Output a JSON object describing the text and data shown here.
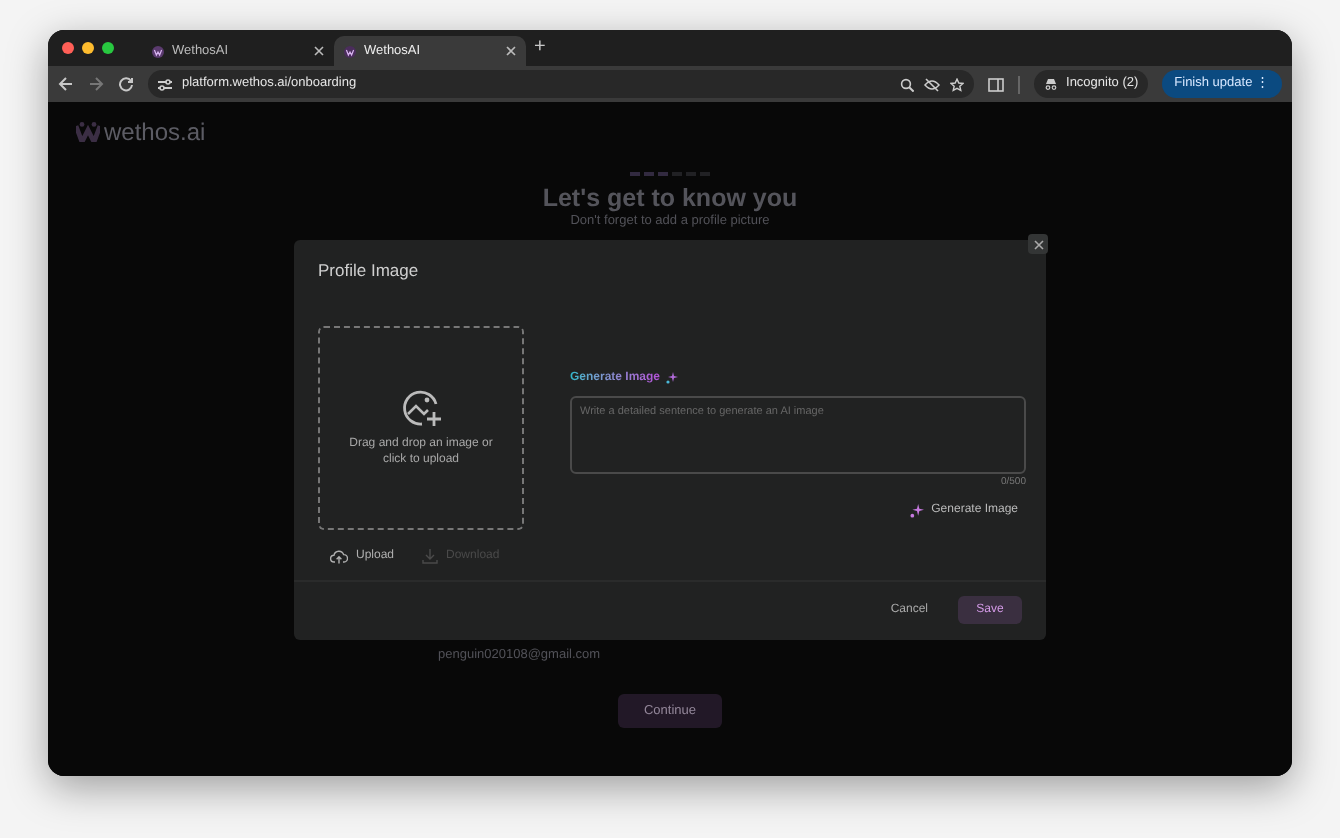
{
  "browser": {
    "tabs": [
      {
        "title": "WethosAI",
        "selected": false
      },
      {
        "title": "WethosAI",
        "selected": true
      }
    ],
    "new_tab_button": "+",
    "url": "platform.wethos.ai/onboarding",
    "profile": "Incognito (2)",
    "update_button": "Finish update ⋮"
  },
  "page": {
    "logo": "wethos.ai",
    "steps": [
      {
        "active": true
      },
      {
        "active": true
      },
      {
        "active": true
      },
      {
        "active": false
      },
      {
        "active": false
      },
      {
        "active": false
      }
    ],
    "heading": "Let's get to know you",
    "subtitle": "Don't forget to add a profile picture",
    "email": "penguin020108@gmail.com",
    "continue_button": "Continue"
  },
  "modal": {
    "title": "Profile Image",
    "dropzone_text": "Drag and drop an image or click to upload",
    "upload": {
      "label": "Upload",
      "disabled": false
    },
    "download": {
      "label": "Download",
      "disabled": true
    },
    "generate_label": "Generate Image",
    "prompt_placeholder": "Write a detailed sentence to generate an AI image",
    "counter": "0/500",
    "generate_button": "Generate Image",
    "cancel_button": "Cancel",
    "save_button": "Save"
  }
}
